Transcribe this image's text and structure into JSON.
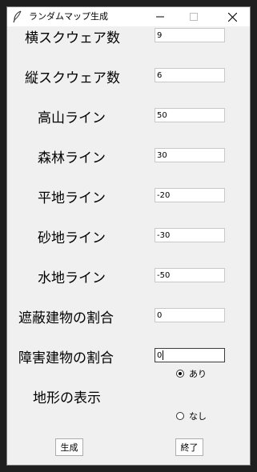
{
  "window": {
    "title": "ランダムマップ生成",
    "icon": "feather-icon"
  },
  "form": {
    "rows": [
      {
        "label": "横スクウェア数",
        "value": "9"
      },
      {
        "label": "縦スクウェア数",
        "value": "6"
      },
      {
        "label": "高山ライン",
        "value": "50"
      },
      {
        "label": "森林ライン",
        "value": "30"
      },
      {
        "label": "平地ライン",
        "value": "-20"
      },
      {
        "label": "砂地ライン",
        "value": "-30"
      },
      {
        "label": "水地ライン",
        "value": "-50"
      },
      {
        "label": "遮蔽建物の割合",
        "value": "0"
      },
      {
        "label": "障害建物の割合",
        "value": "0"
      }
    ],
    "terrain_display": {
      "label": "地形の表示",
      "options": [
        {
          "label": "あり",
          "checked": true
        },
        {
          "label": "なし",
          "checked": false
        }
      ]
    }
  },
  "buttons": {
    "generate": "生成",
    "quit": "終了"
  }
}
